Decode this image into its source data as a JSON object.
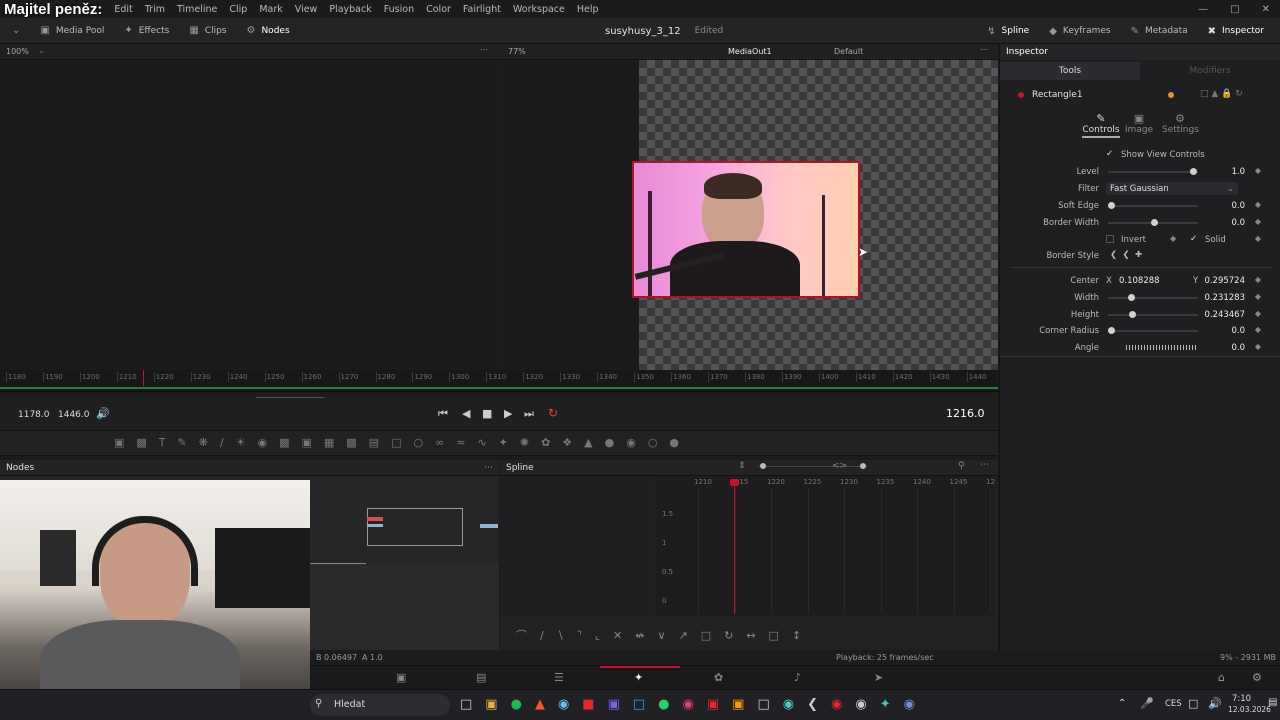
{
  "menubar": {
    "brand": "Majitel peněz:",
    "items": [
      "Edit",
      "Trim",
      "Timeline",
      "Clip",
      "Mark",
      "View",
      "Playback",
      "Fusion",
      "Color",
      "Fairlight",
      "Workspace",
      "Help"
    ]
  },
  "toolbar": {
    "media_pool": "Media Pool",
    "effects": "Effects",
    "clips": "Clips",
    "nodes": "Nodes",
    "project_name": "susyhusy_3_12",
    "project_status": "Edited",
    "spline": "Spline",
    "keyframes": "Keyframes",
    "metadata": "Metadata",
    "inspector": "Inspector"
  },
  "subbar": {
    "left_zoom": "100%",
    "viewer_zoom": "77%",
    "viewer_name": "MediaOut1",
    "viewer_lut": "Default"
  },
  "inspector": {
    "title": "Inspector",
    "tab_tools": "Tools",
    "tab_modifiers": "Modifiers",
    "node_name": "Rectangle1",
    "subtabs": [
      "Controls",
      "Image",
      "Settings"
    ],
    "show_view_controls": "Show View Controls",
    "level_label": "Level",
    "level_value": "1.0",
    "level_fraction": 0.95,
    "filter_label": "Filter",
    "filter_value": "Fast Gaussian",
    "soft_edge_label": "Soft Edge",
    "soft_edge_value": "0.0",
    "soft_edge_fraction": 0.0,
    "border_width_label": "Border Width",
    "border_width_value": "0.0",
    "border_width_fraction": 0.5,
    "invert_label": "Invert",
    "solid_label": "Solid",
    "border_style_label": "Border Style",
    "center_label": "Center",
    "center_x_axis": "X",
    "center_x": "0.108288",
    "center_y_axis": "Y",
    "center_y": "0.295724",
    "width_label": "Width",
    "width_value": "0.231283",
    "width_fraction": 0.23,
    "height_label": "Height",
    "height_value": "0.243467",
    "height_fraction": 0.24,
    "corner_radius_label": "Corner Radius",
    "corner_radius_value": "0.0",
    "corner_radius_fraction": 0.0,
    "angle_label": "Angle",
    "angle_value": "0.0"
  },
  "ruler": {
    "ticks": [
      "1180",
      "1190",
      "1200",
      "1210",
      "1220",
      "1230",
      "1240",
      "1250",
      "1260",
      "1270",
      "1280",
      "1290",
      "1300",
      "1310",
      "1320",
      "1330",
      "1340",
      "1350",
      "1360",
      "1370",
      "1380",
      "1390",
      "1400",
      "1410",
      "1420",
      "1430",
      "1440"
    ]
  },
  "transport": {
    "start": "1178.0",
    "end": "1446.0",
    "current_frame": "1216.0"
  },
  "nodes_panel": {
    "title": "Nodes"
  },
  "spline_panel": {
    "title": "Spline",
    "ticks": [
      "1210",
      "1215",
      "1220",
      "1225",
      "1230",
      "1235",
      "1240",
      "1245",
      "12"
    ],
    "y_labels": [
      "1.5",
      "1",
      "0.5",
      "0"
    ]
  },
  "status": {
    "left": "B 0.06497",
    "alpha": "A 1.0",
    "playback": "Playback: 25 frames/sec",
    "memory": "9% - 2931 MB"
  },
  "taskbar": {
    "search_placeholder": "Hledat",
    "language": "CES",
    "time": "7:10",
    "date": "12.03.2026"
  },
  "colors": {
    "accent_red": "#b0122a",
    "background": "#1c1c1e",
    "panel": "#242427"
  }
}
